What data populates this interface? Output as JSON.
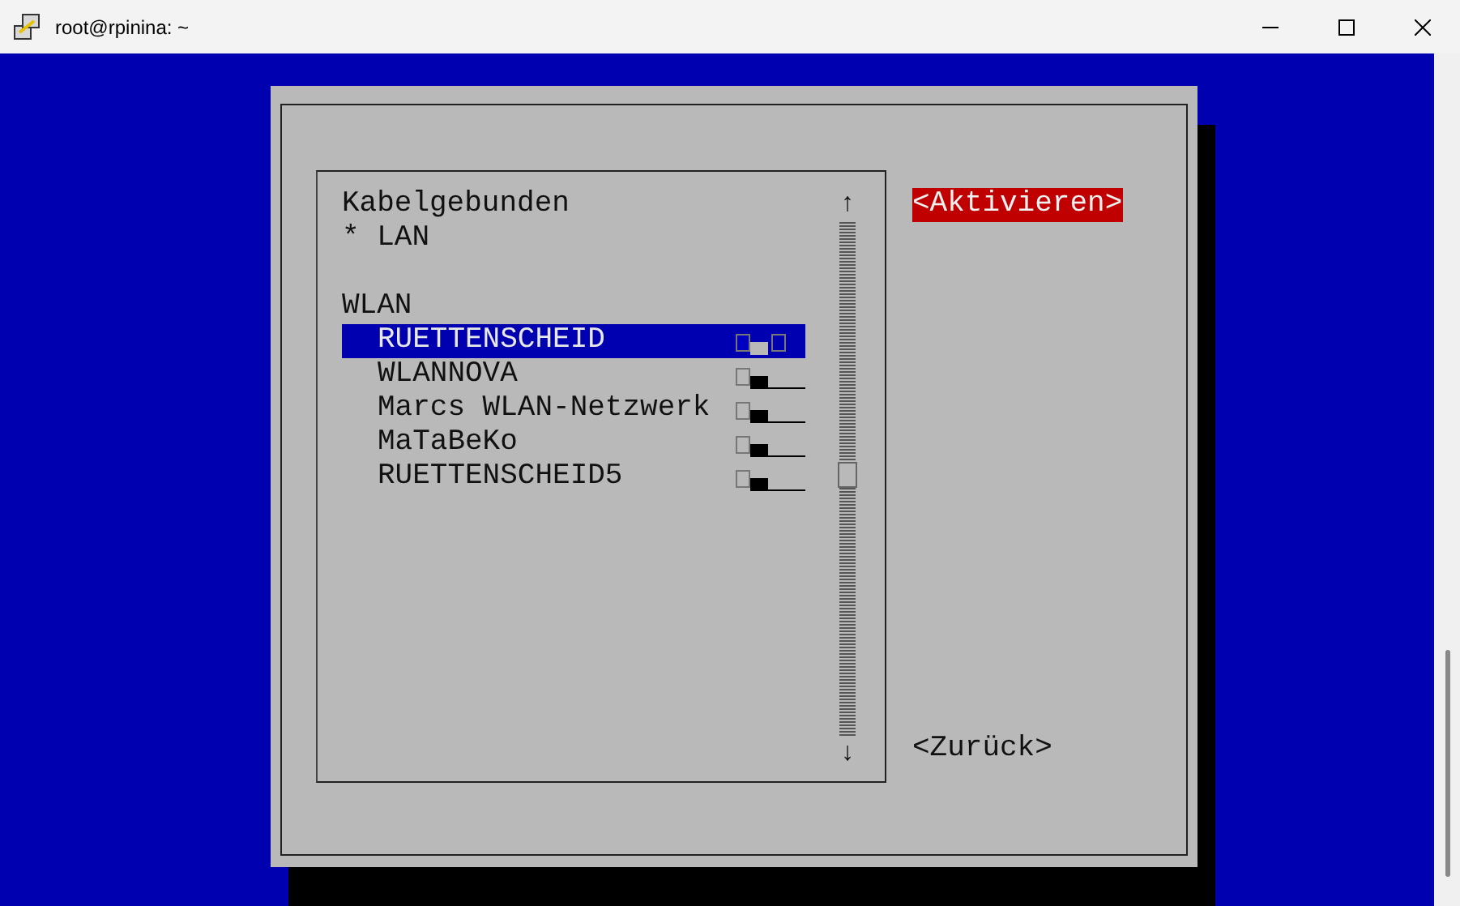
{
  "window": {
    "title": "root@rpinina: ~"
  },
  "list": {
    "sections": [
      {
        "heading": "Kabelgebunden",
        "items": [
          {
            "label": "* LAN",
            "kind": "wired",
            "selected": false
          }
        ]
      },
      {
        "heading": "WLAN",
        "items": [
          {
            "label": "RUETTENSCHEID",
            "kind": "wifi",
            "selected": true
          },
          {
            "label": "WLANNOVA",
            "kind": "wifi",
            "selected": false
          },
          {
            "label": "Marcs WLAN-Netzwerk",
            "kind": "wifi",
            "selected": false
          },
          {
            "label": "MaTaBeKo",
            "kind": "wifi",
            "selected": false
          },
          {
            "label": "RUETTENSCHEID5",
            "kind": "wifi",
            "selected": false
          }
        ]
      }
    ],
    "scroll_up": "↑",
    "scroll_down": "↓"
  },
  "buttons": [
    {
      "label": "<Aktivieren>",
      "selected": true
    },
    {
      "label": "<Zurück>",
      "selected": false
    }
  ]
}
